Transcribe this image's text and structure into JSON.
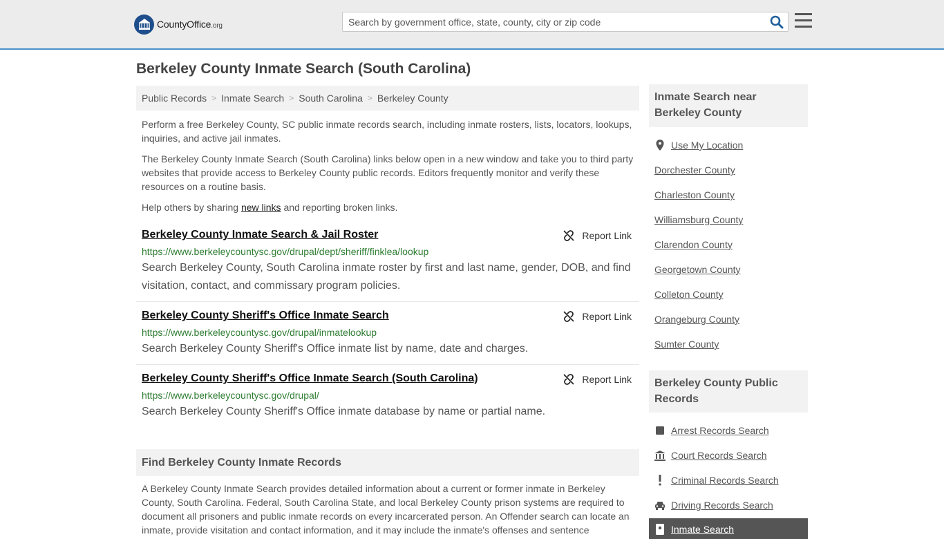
{
  "header": {
    "logo_main": "CountyOffice",
    "logo_suffix": ".org",
    "search_placeholder": "Search by government office, state, county, city or zip code"
  },
  "page_title": "Berkeley County Inmate Search (South Carolina)",
  "breadcrumb": [
    "Public Records",
    "Inmate Search",
    "South Carolina",
    "Berkeley County"
  ],
  "intro": {
    "p1": "Perform a free Berkeley County, SC public inmate records search, including inmate rosters, lists, locators, lookups, inquiries, and active jail inmates.",
    "p2": "The Berkeley County Inmate Search (South Carolina) links below open in a new window and take you to third party websites that provide access to Berkeley County public records. Editors frequently monitor and verify these resources on a routine basis.",
    "p3_before": "Help others by sharing ",
    "p3_link": "new links",
    "p3_after": " and reporting broken links."
  },
  "report_label": "Report Link",
  "results": [
    {
      "title": "Berkeley County Inmate Search & Jail Roster",
      "url": "https://www.berkeleycountysc.gov/drupal/dept/sheriff/finklea/lookup",
      "desc": "Search Berkeley County, South Carolina inmate roster by first and last name, gender, DOB, and find visitation, contact, and commissary program policies."
    },
    {
      "title": "Berkeley County Sheriff's Office Inmate Search",
      "url": "https://www.berkeleycountysc.gov/drupal/inmatelookup",
      "desc": "Search Berkeley County Sheriff's Office inmate list by name, date and charges."
    },
    {
      "title": "Berkeley County Sheriff's Office Inmate Search (South Carolina)",
      "url": "https://www.berkeleycountysc.gov/drupal/",
      "desc": "Search Berkeley County Sheriff's Office inmate database by name or partial name."
    }
  ],
  "find_section": {
    "heading": "Find Berkeley County Inmate Records",
    "body": "A Berkeley County Inmate Search provides detailed information about a current or former inmate in Berkeley County, South Carolina. Federal, South Carolina State, and local Berkeley County prison systems are required to document all prisoners and public inmate records on every incarcerated person. An Offender search can locate an inmate, provide visitation and contact information, and it may include the inmate's offenses and sentence"
  },
  "sidebar": {
    "nearby_heading": "Inmate Search near Berkeley County",
    "use_location": "Use My Location",
    "nearby": [
      "Dorchester County",
      "Charleston County",
      "Williamsburg County",
      "Clarendon County",
      "Georgetown County",
      "Colleton County",
      "Orangeburg County",
      "Sumter County"
    ],
    "records_heading": "Berkeley County Public Records",
    "records": [
      {
        "label": "Arrest Records Search",
        "icon": "square-icon"
      },
      {
        "label": "Court Records Search",
        "icon": "courthouse-icon"
      },
      {
        "label": "Criminal Records Search",
        "icon": "exclamation-icon"
      },
      {
        "label": "Driving Records Search",
        "icon": "car-icon"
      }
    ],
    "active": "Inmate Search"
  },
  "colors": {
    "accent_line": "#4a90c8",
    "logo_blue": "#1f4e8c",
    "url_green": "#2e7d32",
    "search_icon": "#1f5f9c"
  }
}
